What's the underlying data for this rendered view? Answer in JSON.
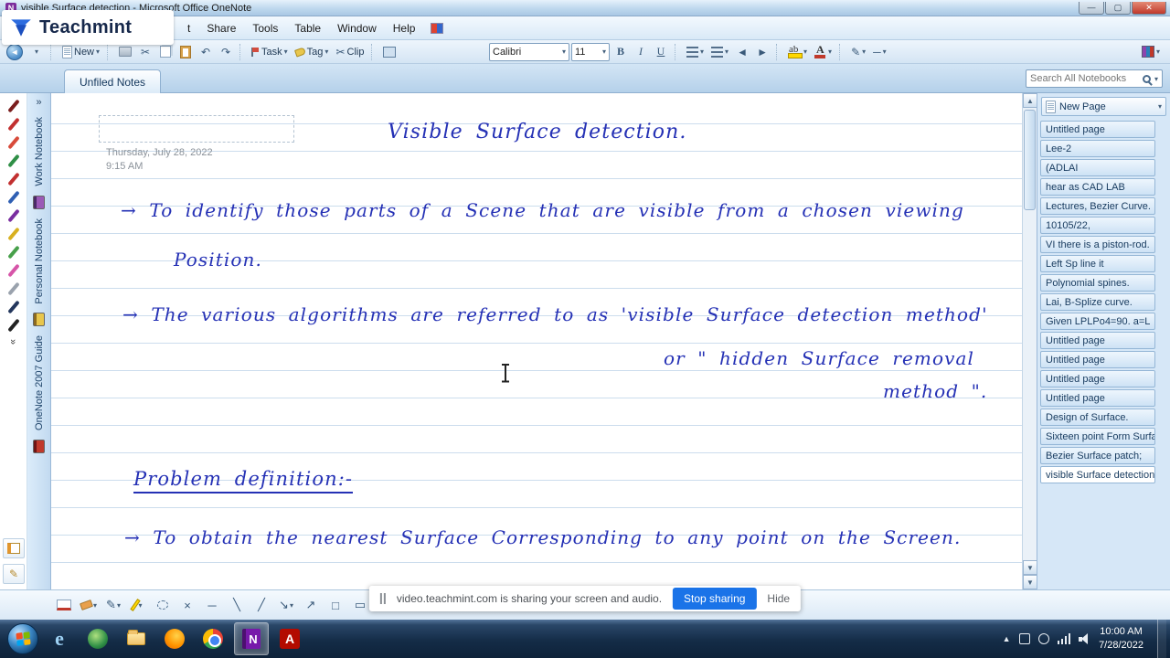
{
  "window": {
    "title": "visible Surface detection - Microsoft Office OneNote",
    "brand": "Teachmint"
  },
  "menu": {
    "items": [
      "t",
      "Share",
      "Tools",
      "Table",
      "Window",
      "Help"
    ]
  },
  "toolbar": {
    "new": "New",
    "task": "Task",
    "tag": "Tag",
    "clip": "Clip",
    "font": "Calibri",
    "size": "11",
    "bold": "B",
    "italic": "I",
    "underline": "U"
  },
  "tab": "Unfiled Notes",
  "search": {
    "placeholder": "Search All Notebooks"
  },
  "notebooks": [
    "Work Notebook",
    "Personal Notebook",
    "OneNote 2007 Guide"
  ],
  "pens": [
    "#7a1d1d",
    "#c23030",
    "#d84b3a",
    "#2f8f46",
    "#c23030",
    "#2f5fb3",
    "#7a2ea0",
    "#d8b020",
    "#47a04a",
    "#d655a8",
    "#9aa2ad",
    "#23365c",
    "#222222"
  ],
  "note": {
    "title": "Visible Surface detection.",
    "date": "Thursday, July 28, 2022",
    "time": "9:15 AM",
    "lines": [
      "→ To identify those parts of a Scene that are visible from a chosen viewing",
      "Position.",
      "→ The various algorithms are referred to as 'visible Surface detection method'",
      "or \" hidden Surface removal",
      "method \".",
      "Problem definition:-",
      "→ To obtain the nearest Surface Corresponding to any point on the Screen."
    ]
  },
  "page_list": {
    "header": "New Page",
    "items": [
      {
        "label": "Untitled page"
      },
      {
        "label": "Lee-2"
      },
      {
        "label": "(ADLAI"
      },
      {
        "label": "hear as CAD LAB"
      },
      {
        "label": "Lectures, Bezier Curve."
      },
      {
        "label": "10105/22,"
      },
      {
        "label": "VI there is a piston-rod."
      },
      {
        "label": "Left Sp line it"
      },
      {
        "label": "Polynomial spines."
      },
      {
        "label": "Lai, B-Splize curve."
      },
      {
        "label": "Given LPLPo4=90. a=L"
      },
      {
        "label": "Untitled page"
      },
      {
        "label": "Untitled page"
      },
      {
        "label": "Untitled page"
      },
      {
        "label": "Untitled page"
      },
      {
        "label": "Design of Surface."
      },
      {
        "label": "Sixteen point Form Surfa"
      },
      {
        "label": "Bezier Surface patch;"
      },
      {
        "label": "visible Surface detection"
      }
    ]
  },
  "share_bar": {
    "message": "video.teachmint.com is sharing your screen and audio.",
    "stop": "Stop sharing",
    "hide": "Hide"
  },
  "taskbar": {
    "time": "10:00 AM",
    "date": "7/28/2022"
  },
  "colors": {
    "accent_blue": "#1a73e8",
    "ink": "#2531b5"
  }
}
